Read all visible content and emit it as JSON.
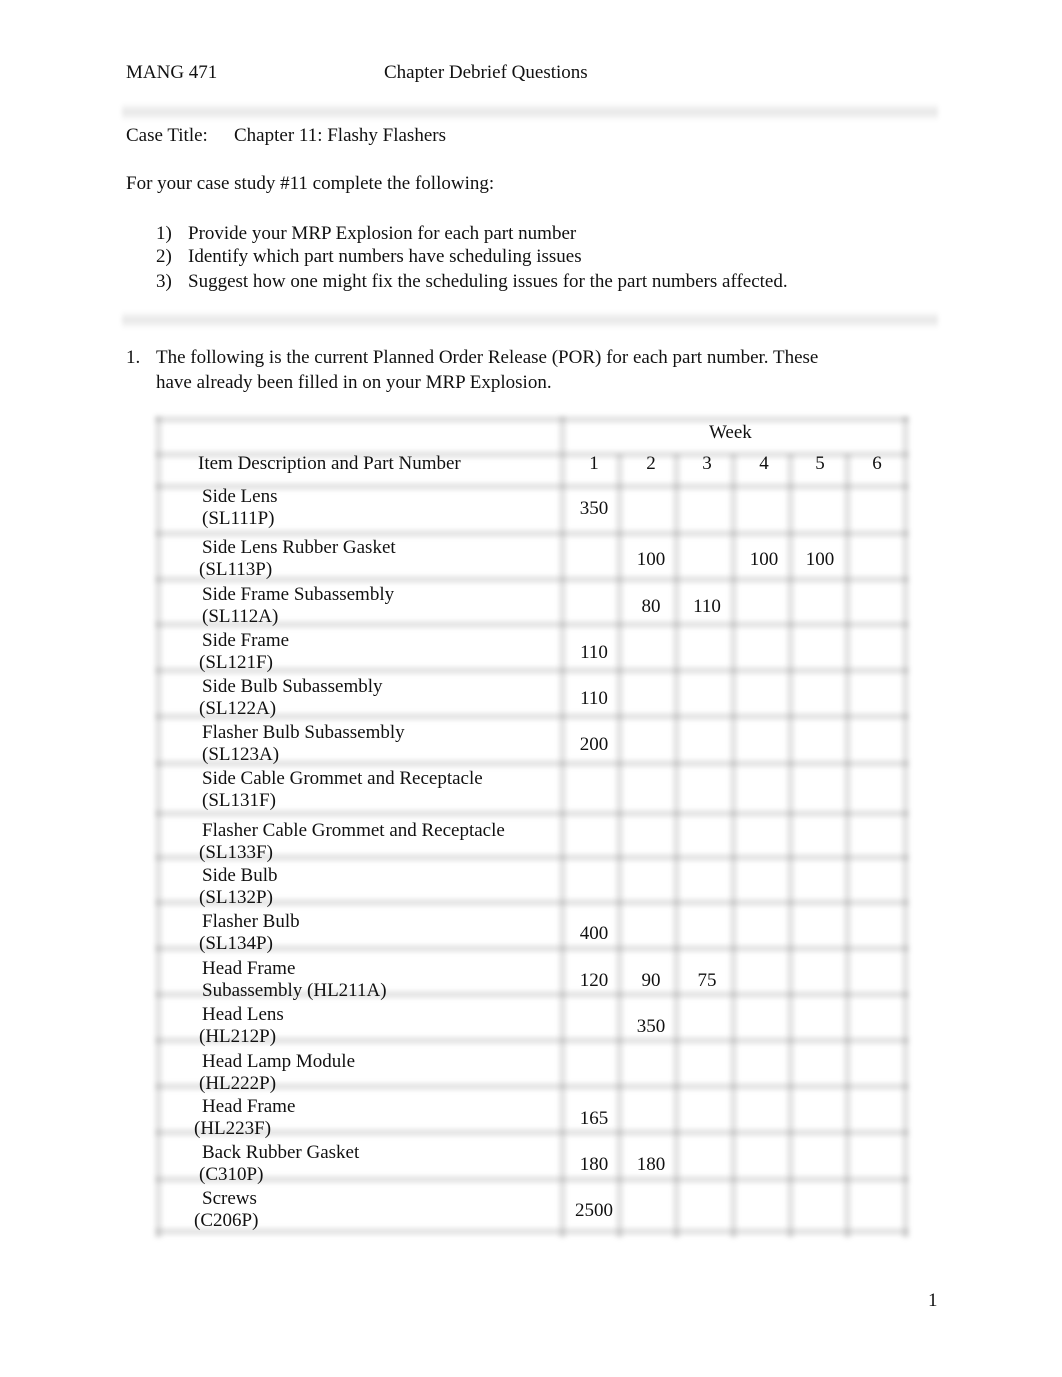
{
  "header": {
    "course": "MANG 471",
    "title": "Chapter Debrief Questions"
  },
  "case": {
    "label": "Case Title:",
    "title": "Chapter 11: Flashy Flashers"
  },
  "intro": "For your case study #11 complete the following:",
  "tasks": [
    {
      "num": "1)",
      "text": "Provide your MRP Explosion for each part number"
    },
    {
      "num": "2)",
      "text": "Identify which part numbers have scheduling issues"
    },
    {
      "num": "3)",
      "text": "Suggest how one might fix the scheduling issues for the part numbers affected."
    }
  ],
  "question": {
    "num": "1.",
    "line1": "The following is the current Planned Order Release (POR) for each part number. These",
    "line2": "have already been filled in on your MRP Explosion."
  },
  "table": {
    "week_header": "Week",
    "item_header": "Item Description and Part Number",
    "weeks": [
      "1",
      "2",
      "3",
      "4",
      "5",
      "6"
    ],
    "rows": [
      {
        "line1": "Side Lens",
        "line2": "(SL111P)",
        "values": [
          "350",
          "",
          "",
          "",
          "",
          ""
        ]
      },
      {
        "line1": "Side Lens Rubber Gasket",
        "line2": "(SL113P)",
        "values": [
          "",
          "100",
          "",
          "100",
          "100",
          ""
        ]
      },
      {
        "line1": "Side Frame Subassembly",
        "line2": "(SL112A)",
        "values": [
          "",
          "80",
          "110",
          "",
          "",
          ""
        ]
      },
      {
        "line1": "Side Frame",
        "line2": "(SL121F)",
        "values": [
          "110",
          "",
          "",
          "",
          "",
          ""
        ]
      },
      {
        "line1": "Side Bulb Subassembly",
        "line2": "(SL122A)",
        "values": [
          "110",
          "",
          "",
          "",
          "",
          ""
        ]
      },
      {
        "line1": "Flasher Bulb Subassembly",
        "line2": "(SL123A)",
        "values": [
          "200",
          "",
          "",
          "",
          "",
          ""
        ]
      },
      {
        "line1": "Side Cable Grommet and Receptacle",
        "line2": "(SL131F)",
        "values": [
          "",
          "",
          "",
          "",
          "",
          ""
        ]
      },
      {
        "line1": "Flasher Cable Grommet and Receptacle",
        "line2": "(SL133F)",
        "values": [
          "",
          "",
          "",
          "",
          "",
          ""
        ]
      },
      {
        "line1": "Side Bulb",
        "line2": "(SL132P)",
        "values": [
          "",
          "",
          "",
          "",
          "",
          ""
        ]
      },
      {
        "line1": "Flasher Bulb",
        "line2": "(SL134P)",
        "values": [
          "400",
          "",
          "",
          "",
          "",
          ""
        ]
      },
      {
        "line1": "Head Frame",
        "line2": "Subassembly (HL211A)",
        "values": [
          "120",
          "90",
          "75",
          "",
          "",
          ""
        ]
      },
      {
        "line1": "Head Lens",
        "line2": "(HL212P)",
        "values": [
          "",
          "350",
          "",
          "",
          "",
          ""
        ]
      },
      {
        "line1": "Head Lamp Module",
        "line2": "(HL222P)",
        "values": [
          "",
          "",
          "",
          "",
          "",
          ""
        ]
      },
      {
        "line1": "Head Frame",
        "line2": "(HL223F)",
        "values": [
          "165",
          "",
          "",
          "",
          "",
          ""
        ]
      },
      {
        "line1": "Back Rubber Gasket",
        "line2": "(C310P)",
        "values": [
          "180",
          "180",
          "",
          "",
          "",
          ""
        ]
      },
      {
        "line1": "Screws",
        "line2": "(C206P)",
        "values": [
          "2500",
          "",
          "",
          "",
          "",
          ""
        ]
      }
    ]
  },
  "page_number": "1"
}
